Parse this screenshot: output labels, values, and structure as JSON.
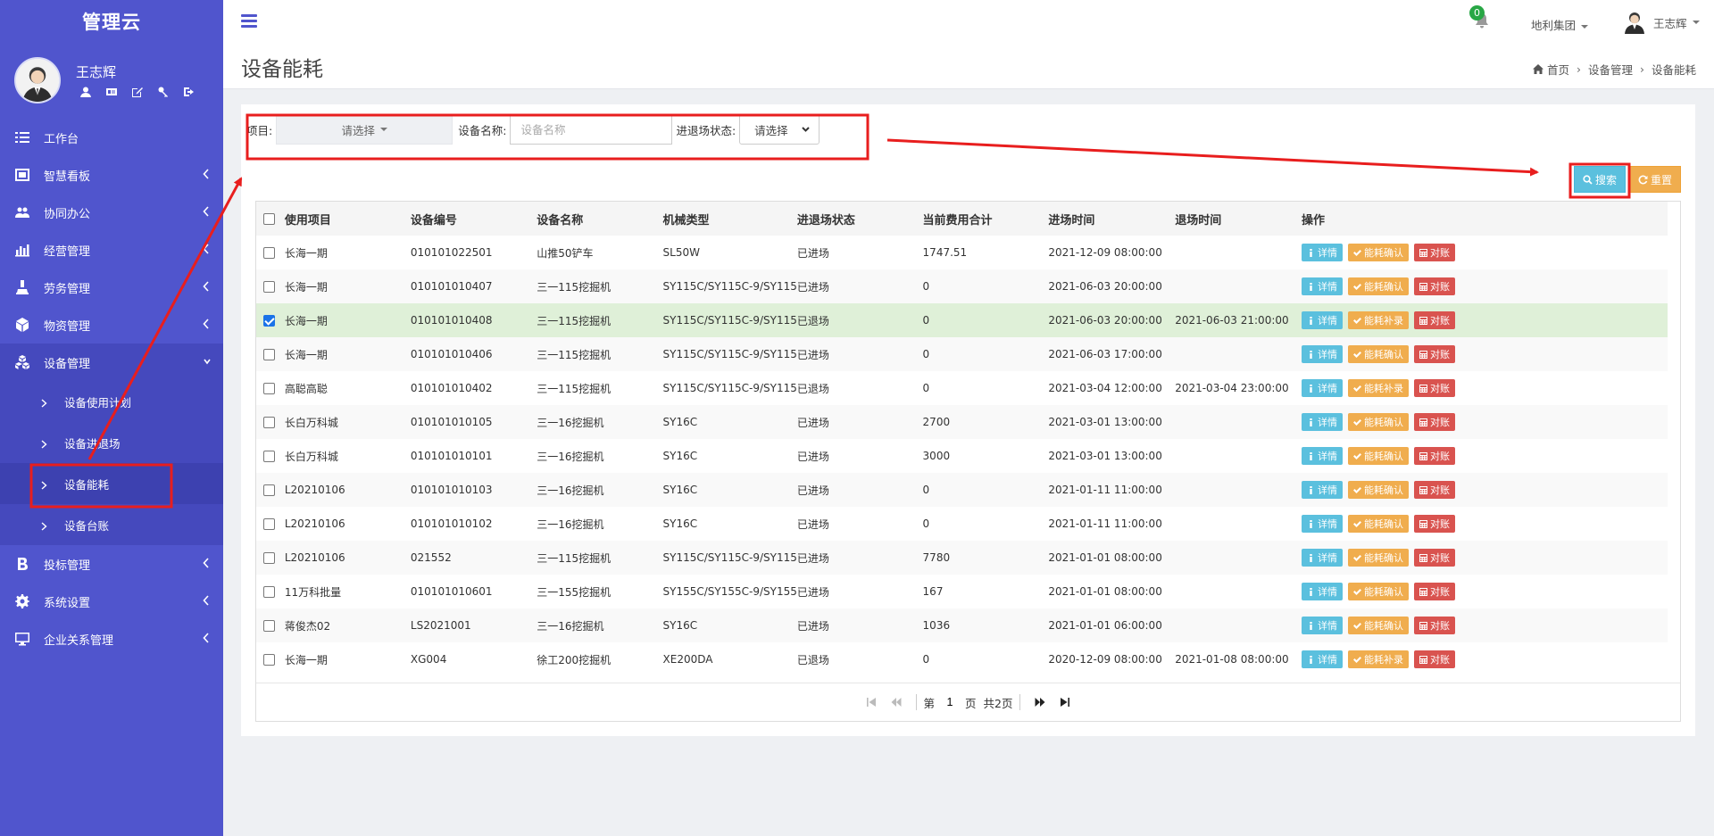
{
  "brand": "管理云",
  "user": {
    "name": "王志辉"
  },
  "menu": [
    {
      "label": "工作台"
    },
    {
      "label": "智慧看板"
    },
    {
      "label": "协同办公"
    },
    {
      "label": "经营管理"
    },
    {
      "label": "劳务管理"
    },
    {
      "label": "物资管理"
    },
    {
      "label": "设备管理"
    },
    {
      "label": "投标管理"
    },
    {
      "label": "系统设置"
    },
    {
      "label": "企业关系管理"
    }
  ],
  "submenu": [
    {
      "label": "设备使用计划"
    },
    {
      "label": "设备进退场"
    },
    {
      "label": "设备能耗"
    },
    {
      "label": "设备台账"
    }
  ],
  "topbar": {
    "badge": "0",
    "org": "地利集团",
    "user": "王志辉"
  },
  "header": {
    "title": "设备能耗",
    "breadcrumb": [
      "首页",
      "设备管理",
      "设备能耗"
    ]
  },
  "filter": {
    "project_label": "项目:",
    "project_value": "请选择",
    "name_label": "设备名称:",
    "name_placeholder": "设备名称",
    "status_label": "进退场状态:",
    "status_value": "请选择",
    "search": "搜索",
    "reset": "重置"
  },
  "table": {
    "columns": [
      "使用项目",
      "设备编号",
      "设备名称",
      "机械类型",
      "进退场状态",
      "当前费用合计",
      "进场时间",
      "退场时间",
      "操作"
    ],
    "btn_detail": "详情",
    "btn_confirm": "能耗确认",
    "btn_supplement": "能耗补录",
    "btn_reconcile": "对账",
    "rows": [
      {
        "project": "长海一期",
        "code": "010101022501",
        "name": "山推50铲车",
        "type": "SL50W",
        "status": "已进场",
        "cost": "1747.51",
        "in": "2021-12-09 08:00:00",
        "out": "",
        "op": "confirm",
        "checked": false
      },
      {
        "project": "长海一期",
        "code": "010101010407",
        "name": "三一115挖掘机",
        "type": "SY115C/SY115C-9/SY115",
        "status": "已进场",
        "cost": "0",
        "in": "2021-06-03 20:00:00",
        "out": "",
        "op": "confirm",
        "checked": false
      },
      {
        "project": "长海一期",
        "code": "010101010408",
        "name": "三一115挖掘机",
        "type": "SY115C/SY115C-9/SY115",
        "status": "已退场",
        "cost": "0",
        "in": "2021-06-03 20:00:00",
        "out": "2021-06-03 21:00:00",
        "op": "supplement",
        "checked": true
      },
      {
        "project": "长海一期",
        "code": "010101010406",
        "name": "三一115挖掘机",
        "type": "SY115C/SY115C-9/SY115",
        "status": "已进场",
        "cost": "0",
        "in": "2021-06-03 17:00:00",
        "out": "",
        "op": "confirm",
        "checked": false
      },
      {
        "project": "高聪高聪",
        "code": "010101010402",
        "name": "三一115挖掘机",
        "type": "SY115C/SY115C-9/SY115",
        "status": "已退场",
        "cost": "0",
        "in": "2021-03-04 12:00:00",
        "out": "2021-03-04 23:00:00",
        "op": "supplement",
        "checked": false
      },
      {
        "project": "长白万科城",
        "code": "010101010105",
        "name": "三一16挖掘机",
        "type": "SY16C",
        "status": "已进场",
        "cost": "2700",
        "in": "2021-03-01 13:00:00",
        "out": "",
        "op": "confirm",
        "checked": false
      },
      {
        "project": "长白万科城",
        "code": "010101010101",
        "name": "三一16挖掘机",
        "type": "SY16C",
        "status": "已进场",
        "cost": "3000",
        "in": "2021-03-01 13:00:00",
        "out": "",
        "op": "confirm",
        "checked": false
      },
      {
        "project": "L20210106",
        "code": "010101010103",
        "name": "三一16挖掘机",
        "type": "SY16C",
        "status": "已进场",
        "cost": "0",
        "in": "2021-01-11 11:00:00",
        "out": "",
        "op": "confirm",
        "checked": false
      },
      {
        "project": "L20210106",
        "code": "010101010102",
        "name": "三一16挖掘机",
        "type": "SY16C",
        "status": "已进场",
        "cost": "0",
        "in": "2021-01-11 11:00:00",
        "out": "",
        "op": "confirm",
        "checked": false
      },
      {
        "project": "L20210106",
        "code": "021552",
        "name": "三一115挖掘机",
        "type": "SY115C/SY115C-9/SY115",
        "status": "已进场",
        "cost": "7780",
        "in": "2021-01-01 08:00:00",
        "out": "",
        "op": "confirm",
        "checked": false
      },
      {
        "project": "11万科批量",
        "code": "010101010601",
        "name": "三一155挖掘机",
        "type": "SY155C/SY155C-9/SY155",
        "status": "已进场",
        "cost": "167",
        "in": "2021-01-01 08:00:00",
        "out": "",
        "op": "confirm",
        "checked": false
      },
      {
        "project": "蒋俊杰02",
        "code": "LS2021001",
        "name": "三一16挖掘机",
        "type": "SY16C",
        "status": "已进场",
        "cost": "1036",
        "in": "2021-01-01 06:00:00",
        "out": "",
        "op": "confirm",
        "checked": false
      },
      {
        "project": "长海一期",
        "code": "XG004",
        "name": "徐工200挖掘机",
        "type": "XE200DA",
        "status": "已退场",
        "cost": "0",
        "in": "2020-12-09 08:00:00",
        "out": "2021-01-08 08:00:00",
        "op": "supplement",
        "checked": false
      }
    ]
  },
  "pager": {
    "prefix": "第",
    "page": "1",
    "suffix": "页",
    "total": "共2页"
  },
  "colors": {
    "sidebar": "#5055cd",
    "annotation": "#e81e1e",
    "info": "#5bc0de",
    "warning": "#f0ad4e",
    "danger": "#d9534f"
  }
}
